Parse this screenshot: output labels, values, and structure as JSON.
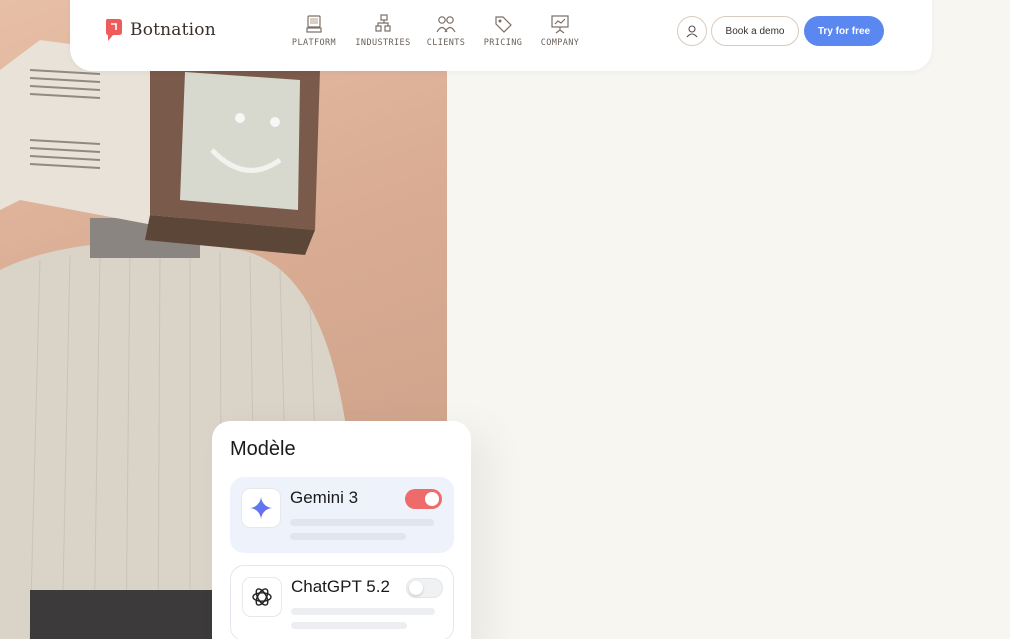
{
  "brand": {
    "name": "Botnation",
    "accent": "#ef5b5b",
    "button_blue": "#5b87f0"
  },
  "nav": {
    "items": [
      {
        "label": "PLATFORM",
        "icon": "computer-icon"
      },
      {
        "label": "INDUSTRIES",
        "icon": "org-chart-icon"
      },
      {
        "label": "CLIENTS",
        "icon": "people-icon"
      },
      {
        "label": "PRICING",
        "icon": "price-tag-icon"
      },
      {
        "label": "COMPANY",
        "icon": "presentation-board-icon"
      }
    ],
    "account_icon": "user-avatar-icon",
    "demo_label": "Book a demo",
    "try_label": "Try for free"
  },
  "hero": {
    "image": "robot-with-tv-head-photo"
  },
  "model_card": {
    "title": "Modèle",
    "models": [
      {
        "name": "Gemini 3",
        "icon": "gemini-sparkle-icon",
        "enabled": true
      },
      {
        "name": "ChatGPT 5.2",
        "icon": "openai-logo-icon",
        "enabled": false
      }
    ]
  }
}
